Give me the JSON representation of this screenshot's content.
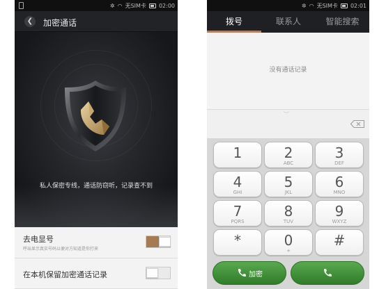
{
  "left": {
    "status": {
      "carrier": "无SIM卡",
      "time": "02:00"
    },
    "header": {
      "back_icon": "back-arrow-icon",
      "title": "加密通话"
    },
    "hero": {
      "icon": "encrypted-shield-phone-icon",
      "description": "私人保密专线，通话防窃听，记录查不到"
    },
    "settings": [
      {
        "title": "去电显号",
        "subtitle": "呼出显示真实号码以便对方知道是你打来",
        "enabled": true
      },
      {
        "title": "在本机保留加密通话记录",
        "subtitle": "",
        "enabled": false
      }
    ],
    "colors": {
      "accent": "#a67a55",
      "background": "#1a1b1e"
    }
  },
  "right": {
    "status": {
      "carrier": "无SIM卡",
      "time": "02:01"
    },
    "tabs": [
      {
        "label": "拨号",
        "active": true
      },
      {
        "label": "联系人",
        "active": false
      },
      {
        "label": "智能搜索",
        "active": false
      }
    ],
    "calllog": {
      "empty_text": "没有通话记录"
    },
    "keys": [
      {
        "digit": "1",
        "letters": ""
      },
      {
        "digit": "2",
        "letters": "ABC"
      },
      {
        "digit": "3",
        "letters": "DEF"
      },
      {
        "digit": "4",
        "letters": "GHI"
      },
      {
        "digit": "5",
        "letters": "JKL"
      },
      {
        "digit": "6",
        "letters": "MNO"
      },
      {
        "digit": "7",
        "letters": "PQRS"
      },
      {
        "digit": "8",
        "letters": "TUV"
      },
      {
        "digit": "9",
        "letters": "WXYZ"
      },
      {
        "digit": "*",
        "letters": ""
      },
      {
        "digit": "0",
        "letters": "+"
      },
      {
        "digit": "#",
        "letters": ""
      }
    ],
    "call_buttons": {
      "encrypted_label": "加密"
    },
    "colors": {
      "call_green": "#3c8f35",
      "tab_indicator": "#b08060"
    }
  }
}
